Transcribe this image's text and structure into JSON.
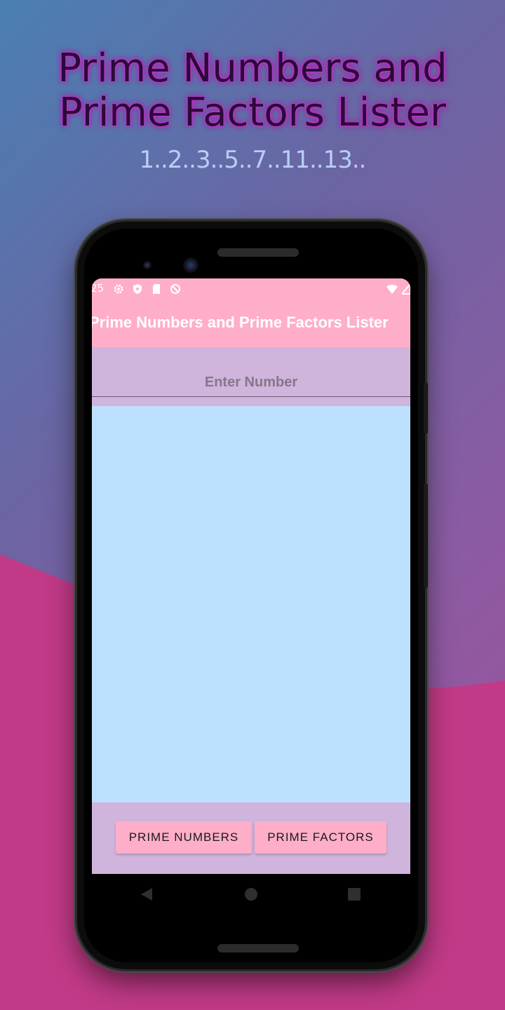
{
  "promo": {
    "title_line1": "Prime Numbers and",
    "title_line2": "Prime Factors Lister",
    "subtitle": "1..2..3..5..7..11..13.."
  },
  "status_bar": {
    "time": "25"
  },
  "app_bar": {
    "title": "Prime Numbers and Prime Factors Lister"
  },
  "input": {
    "placeholder": "Enter Number",
    "value": ""
  },
  "buttons": {
    "prime_numbers": "PRIME NUMBERS",
    "prime_factors": "PRIME FACTORS"
  },
  "icons": {
    "status": [
      "gear-icon",
      "shield-icon",
      "sd-card-icon",
      "no-sync-icon",
      "wifi-icon",
      "signal-icon"
    ],
    "nav": [
      "back-icon",
      "home-icon",
      "recents-icon"
    ]
  },
  "colors": {
    "app_bar": "#ffaec9",
    "body": "#cfb4dc",
    "results": "#bde0fe",
    "button": "#ffaec9"
  }
}
